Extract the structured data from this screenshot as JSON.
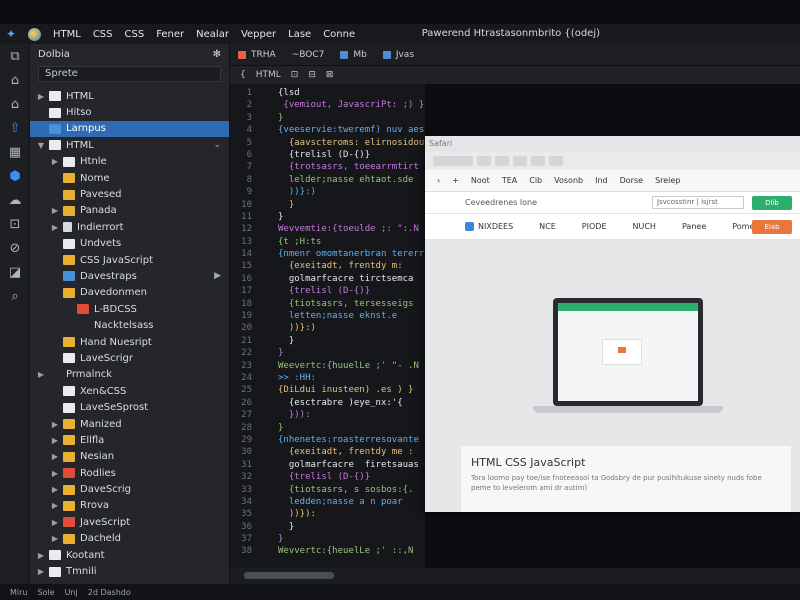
{
  "menubar": {
    "items": [
      "HTML",
      "CSS",
      "CSS",
      "Fener",
      "Nealar",
      "Vepper",
      "Lase",
      "Conne"
    ],
    "window_title": "Pawerend Htrastasonmbrito {(odej)"
  },
  "sidebar": {
    "title": "Dolbia",
    "search_value": "Sprete",
    "items": [
      {
        "label": "HTML",
        "depth": 1,
        "icon": "white",
        "twisty": "▶"
      },
      {
        "label": "Hitso",
        "depth": 1,
        "icon": "white",
        "twisty": ""
      },
      {
        "label": "Larnpus",
        "depth": 1,
        "icon": "blue",
        "twisty": "",
        "selected": true
      },
      {
        "label": "HTML",
        "depth": 1,
        "icon": "white",
        "twisty": "▼",
        "chev": true
      },
      {
        "label": "Htnle",
        "depth": 2,
        "icon": "white",
        "twisty": "▶"
      },
      {
        "label": "Nome",
        "depth": 2,
        "icon": "folder",
        "twisty": ""
      },
      {
        "label": "Pavesed",
        "depth": 2,
        "icon": "folder",
        "twisty": ""
      },
      {
        "label": "Panada",
        "depth": 2,
        "icon": "folder",
        "twisty": "▶"
      },
      {
        "label": "Indierrort",
        "depth": 2,
        "icon": "page",
        "twisty": "▶"
      },
      {
        "label": "Undvets",
        "depth": 2,
        "icon": "white",
        "twisty": ""
      },
      {
        "label": "CSS JavaScript",
        "depth": 2,
        "icon": "folder",
        "twisty": ""
      },
      {
        "label": "Davestraps",
        "depth": 2,
        "icon": "blue",
        "twisty": "",
        "chev_right": true
      },
      {
        "label": "Davedonmen",
        "depth": 2,
        "icon": "folder",
        "twisty": ""
      },
      {
        "label": "L-BDCSS",
        "depth": 3,
        "icon": "red",
        "twisty": ""
      },
      {
        "label": "Nacktelsass",
        "depth": 3,
        "icon": "none",
        "twisty": ""
      },
      {
        "label": "Hand Nuesript",
        "depth": 2,
        "icon": "folder",
        "twisty": ""
      },
      {
        "label": "LaveScrigr",
        "depth": 2,
        "icon": "white",
        "twisty": ""
      },
      {
        "label": "Prmalnck",
        "depth": 1,
        "icon": "none",
        "twisty": "▶"
      },
      {
        "label": "Xen&CSS",
        "depth": 2,
        "icon": "white",
        "twisty": ""
      },
      {
        "label": "LaveSeSprost",
        "depth": 2,
        "icon": "white",
        "twisty": ""
      },
      {
        "label": "Manized",
        "depth": 2,
        "icon": "folder",
        "twisty": "▶"
      },
      {
        "label": "Ellfla",
        "depth": 2,
        "icon": "folder",
        "twisty": "▶"
      },
      {
        "label": "Nesian",
        "depth": 2,
        "icon": "folder",
        "twisty": "▶"
      },
      {
        "label": "Rodlies",
        "depth": 2,
        "icon": "red",
        "twisty": "▶"
      },
      {
        "label": "DaveScrig",
        "depth": 2,
        "icon": "folder",
        "twisty": "▶"
      },
      {
        "label": "Rrova",
        "depth": 2,
        "icon": "folder",
        "twisty": "▶"
      },
      {
        "label": "JaveScript",
        "depth": 2,
        "icon": "red",
        "twisty": "▶"
      },
      {
        "label": "Dacheld",
        "depth": 2,
        "icon": "folder",
        "twisty": "▶"
      },
      {
        "label": "Kootant",
        "depth": 1,
        "icon": "white",
        "twisty": "▶"
      },
      {
        "label": "Tmnili",
        "depth": 1,
        "icon": "white",
        "twisty": "▶"
      }
    ]
  },
  "tabs": [
    {
      "label": "TRHA",
      "color": "#e8603c"
    },
    {
      "label": "~BOC7",
      "color": "#e8603c"
    },
    {
      "label": "Mb",
      "color": "#4b8fd8"
    },
    {
      "label": "Jvas",
      "color": "#4b8fd8"
    }
  ],
  "breadcrumb": [
    "{",
    "HTML",
    "⊡",
    "⊟",
    "⊠"
  ],
  "editor": {
    "line_numbers": [
      1,
      2,
      3,
      4,
      5,
      6,
      7,
      8,
      9,
      10,
      11,
      12,
      13,
      14,
      15,
      16,
      17,
      18,
      19,
      20,
      21,
      22,
      23,
      24,
      25,
      26,
      27,
      28,
      29,
      30,
      31,
      32,
      33,
      34,
      35,
      36,
      37,
      38
    ],
    "lines": [
      "{lsd",
      " {vemiout, JavascriPt: ;) }",
      "}",
      "{veeservie:tweremf) nuv aess }{x }",
      "  {aavscteroms: elirnosidoutcst",
      "  {trelisl (D-{)}",
      "  {trotsasrs, toeearrmtirt",
      "  lelder;nasse ehtaot.sde",
      "  ))}:)",
      "  }",
      "}",
      "Wevvemtie:{toeulde ;: \":.N",
      "{t ;H:ts",
      "{nmenr omomtanerbran tererr",
      "  {exeitadt, frentdy m:",
      "  golmarfcacre tirctsemca",
      "  {trelisl (D-{)}",
      "  {tiotsasrs, tersesseigs",
      "  letten;nasse eknst.e",
      "  ))}:)",
      "  }",
      "}",
      "Weevertc:{huuelLe ;' \"- .N",
      ">> :HH:",
      "{DiLdui inusteen) .es ) }",
      "  {esctrabre )eye_nx:'{",
      "  })):",
      "}",
      "{nhenetes:roasterresovante",
      "  {exeitadt, frentdy me :",
      "  golmarfcacre  firetsauas",
      "  {trelisl (D-{)}",
      "  {tiotsasrs, s sosbos:{.",
      "  ledden;nasse a n poar",
      "  ))}):",
      "  }",
      "}",
      "Wevvertc:{heuelLe ;' ::,N"
    ]
  },
  "browser": {
    "title": "Safari",
    "nav": [
      "Noot",
      "TEA",
      "Cib",
      "Vosonb",
      "Ind",
      "Dorse",
      "Sreiep"
    ],
    "address": "Ceveedrenes lone",
    "select": "Jsvcosstinr | isjrst",
    "green_button": "Dlib",
    "site_nav": [
      "NIXDEES",
      "NCE",
      "PIODE",
      "NUCH",
      "Panee",
      "Pome"
    ],
    "orange_button": "Elab",
    "card_title": "HTML CSS JavaScript",
    "card_text": "Tora loomo pay toe/ise fnoteeasoi ta Godsbry de pur pusihitukuse sinety nuds fobe peme to levelerom  ami  dr autim)"
  },
  "statusbar": [
    "Miru",
    "Sole",
    "Unj",
    "2d Dashdo"
  ],
  "activity_icons": [
    "files-icon",
    "home-icon",
    "git-icon",
    "upload-icon",
    "extensions-icon",
    "debug-icon",
    "cloud-icon",
    "terminal-icon",
    "link-icon",
    "box-icon",
    "search-icon"
  ]
}
